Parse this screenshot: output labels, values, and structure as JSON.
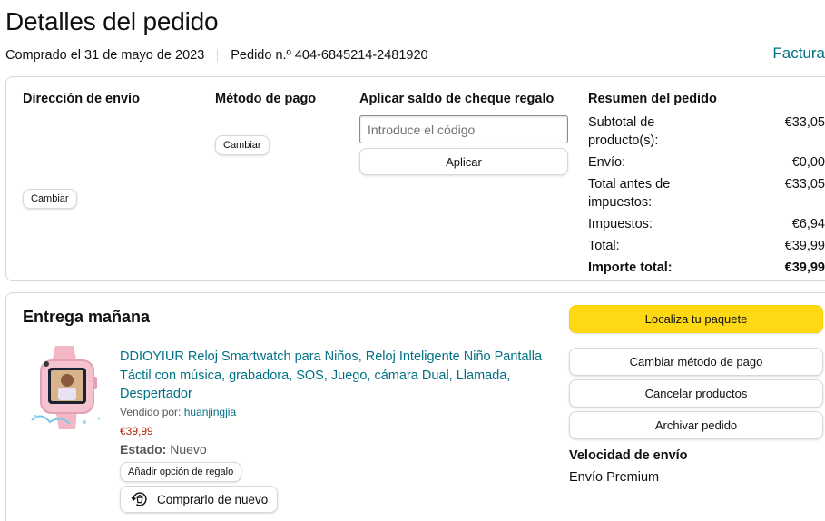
{
  "page": {
    "title": "Detalles del pedido",
    "purchase_date": "Comprado el 31 de mayo de 2023",
    "order_number": "Pedido n.º 404-6845214-2481920",
    "invoice_link": "Factura"
  },
  "shipping": {
    "heading": "Dirección de envío",
    "change_label": "Cambiar"
  },
  "payment": {
    "heading": "Método de pago",
    "change_label": "Cambiar"
  },
  "gift_card": {
    "heading": "Aplicar saldo de cheque regalo",
    "input_placeholder": "Introduce el código",
    "input_value": "",
    "apply_label": "Aplicar"
  },
  "summary": {
    "heading": "Resumen del pedido",
    "rows": [
      {
        "label": "Subtotal de producto(s):",
        "value": "€33,05"
      },
      {
        "label": "Envío:",
        "value": "€0,00"
      },
      {
        "label": "Total antes de impuestos:",
        "value": "€33,05"
      },
      {
        "label": "Impuestos:",
        "value": "€6,94"
      },
      {
        "label": "Total:",
        "value": "€39,99"
      }
    ],
    "grand_total_label": "Importe total:",
    "grand_total_value": "€39,99"
  },
  "delivery": {
    "heading": "Entrega mañana",
    "product": {
      "title": "DDIOYIUR Reloj Smartwatch para Niños, Reloj Inteligente Niño Pantalla Táctil con música, grabadora, SOS, Juego, cámara Dual, Llamada, Despertador",
      "sold_by_label": "Vendido por:",
      "seller": "huanjingjia",
      "price": "€39,99",
      "condition_label": "Estado:",
      "condition": "Nuevo",
      "gift_option_label": "Añadir opción de regalo",
      "buy_again_label": "Comprarlo de nuevo"
    },
    "actions": {
      "track": "Localiza tu paquete",
      "change_payment": "Cambiar método de pago",
      "cancel": "Cancelar productos",
      "archive": "Archivar pedido"
    },
    "speed_heading": "Velocidad de envío",
    "speed_value": "Envío Premium"
  },
  "colors": {
    "link": "#007185",
    "price": "#b12704",
    "primary_button": "#ffd814",
    "border": "#d5d9d9"
  }
}
